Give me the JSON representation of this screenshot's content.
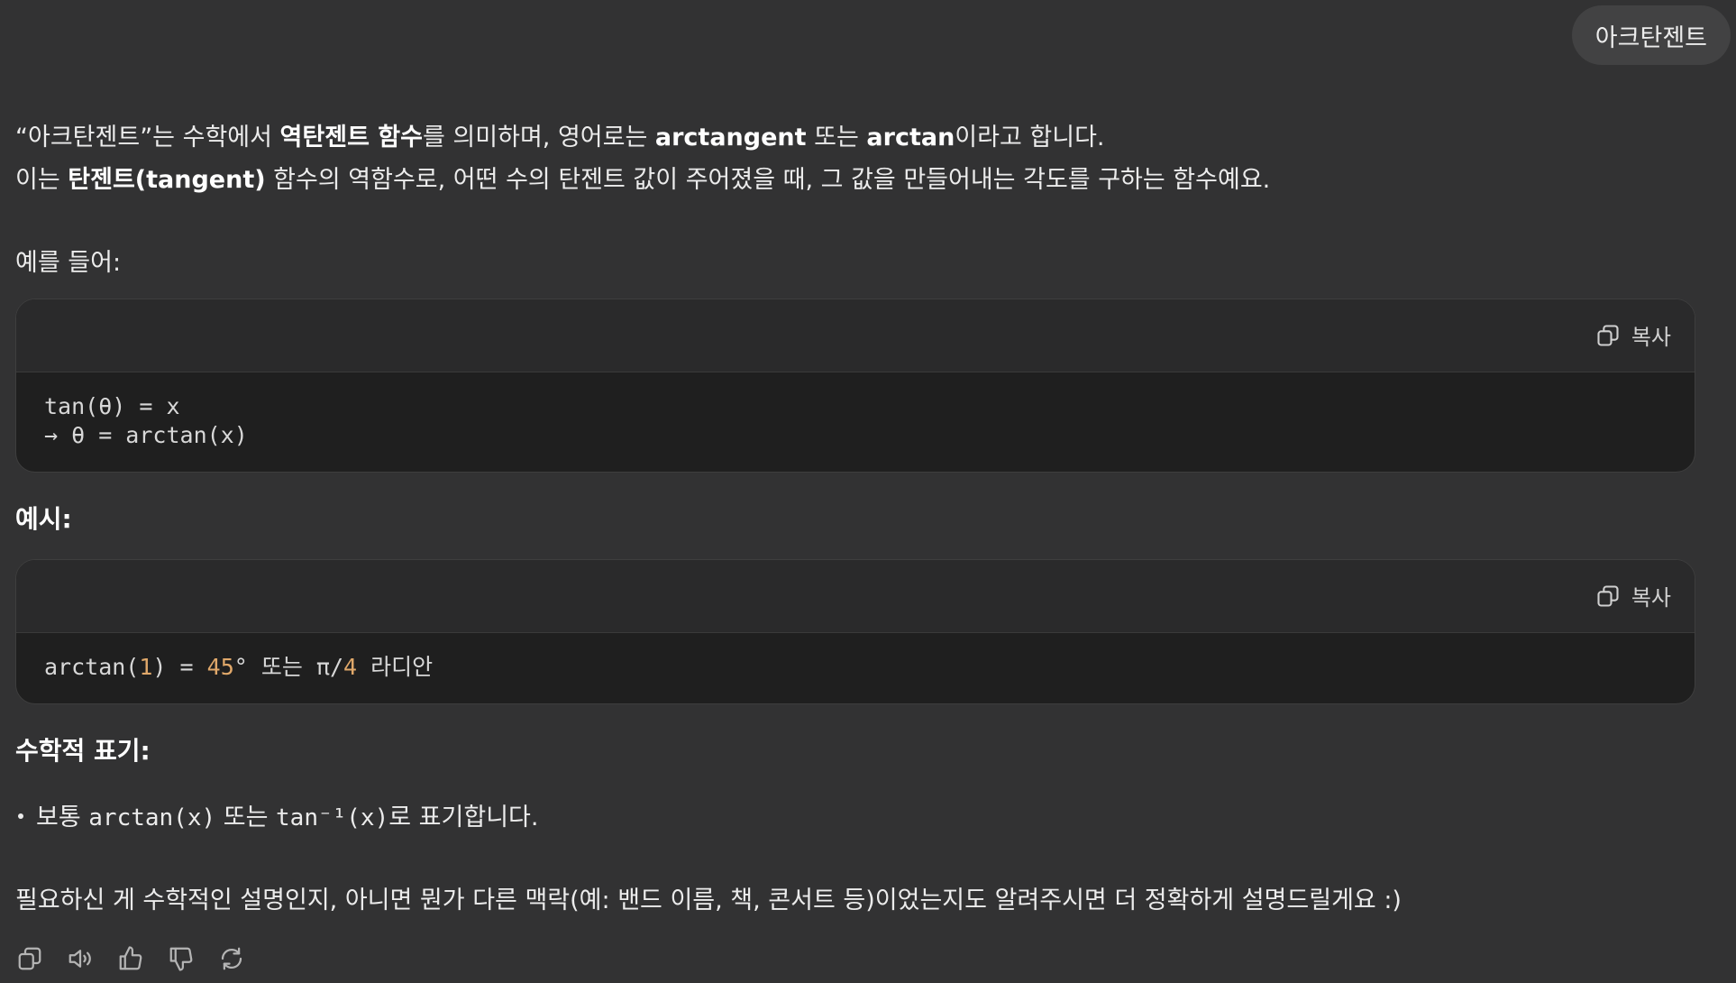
{
  "user_message": "아크탄젠트",
  "answer": {
    "p1": {
      "t1": "“아크탄젠트”는 수학에서 ",
      "b1": "역탄젠트 함수",
      "t2": "를 의미하며, 영어로는 ",
      "b2": "arctangent",
      "t3": " 또는 ",
      "b3": "arctan",
      "t4": "이라고 합니다."
    },
    "p2": {
      "t1": "이는 ",
      "b1": "탄젠트(tangent)",
      "t2": " 함수의 역함수로, 어떤 수의 탄젠트 값이 주어졌을 때, 그 값을 만들어내는 각도를 구하는 함수예요."
    },
    "p3": "예를 들어:",
    "code1": {
      "copy_label": "복사",
      "line1": "tan(θ) = x",
      "line2": "→ θ = arctan(x)"
    },
    "heading_example": "예시:",
    "code2": {
      "copy_label": "복사",
      "a": "arctan(",
      "n1": "1",
      "b": ") = ",
      "n2": "45",
      "c": "° 또는 π/",
      "n3": "4",
      "d": " 라디안"
    },
    "heading_notation": "수학적 표기:",
    "bullet": {
      "t1": "보통 ",
      "c1": "arctan(x)",
      "t2": " 또는 ",
      "c2": "tan⁻¹(x)",
      "t3": "로 표기합니다."
    },
    "closing": "필요하신 게 수학적인 설명인지, 아니면 뭔가 다른 맥락(예: 밴드 이름, 책, 콘서트 등)이었는지도 알려주시면 더 정확하게 설명드릴게요 :)"
  },
  "action_icons": [
    "copy-icon",
    "speaker-icon",
    "thumbs-up-icon",
    "thumbs-down-icon",
    "regenerate-icon"
  ]
}
